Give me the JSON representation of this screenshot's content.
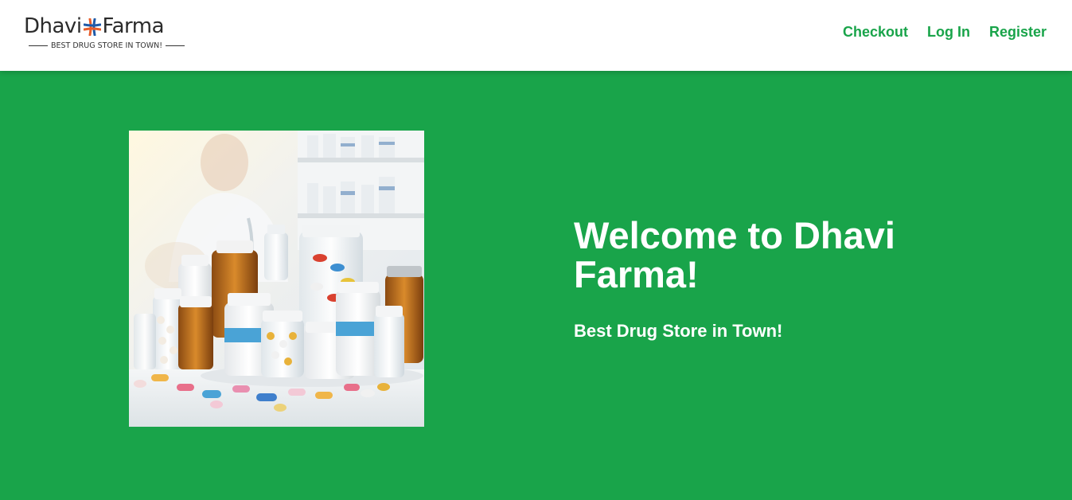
{
  "brand": {
    "name_left": "Dhavi",
    "name_right": "Farma",
    "tagline": "BEST DRUG STORE IN TOWN!",
    "logo_cross_colors": [
      "#e85d2a",
      "#1e5aa8"
    ]
  },
  "nav": {
    "links": [
      {
        "label": "Checkout"
      },
      {
        "label": "Log In"
      },
      {
        "label": "Register"
      }
    ]
  },
  "hero": {
    "title": "Welcome to Dhavi Farma!",
    "subtitle": "Best Drug Store in Town!",
    "image_subject": "pharmacy-medicine-bottles-photo"
  },
  "colors": {
    "brand_green": "#19a44a",
    "navbar_bg": "#ffffff",
    "hero_text": "#ffffff"
  }
}
